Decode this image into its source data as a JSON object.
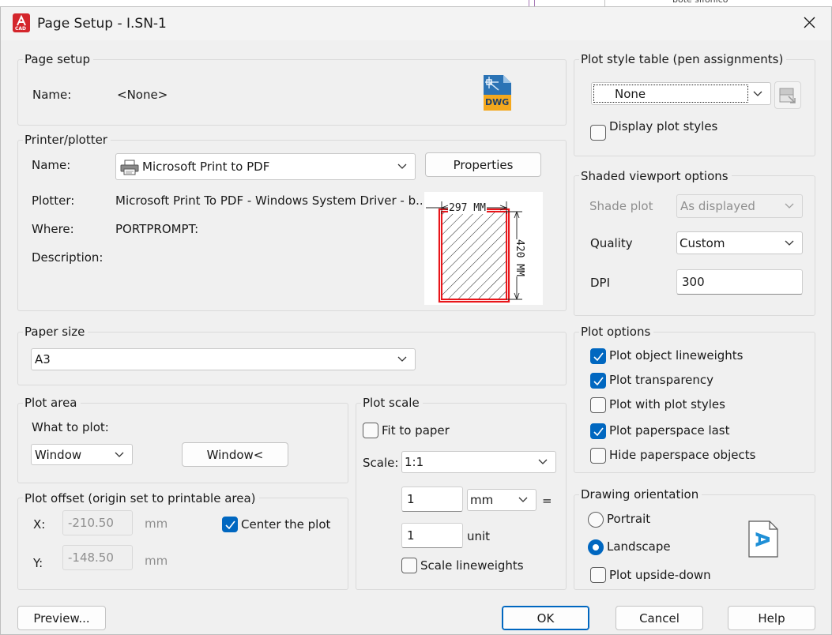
{
  "window": {
    "title": "Page Setup - I.SN-1",
    "app_badge": "CAD",
    "background_text": "bote sifonico"
  },
  "page_setup": {
    "group_label": "Page setup",
    "name_label": "Name:",
    "name_value": "<None>",
    "file_icon_text": "DWG"
  },
  "printer": {
    "group_label": "Printer/plotter",
    "name_label": "Name:",
    "name_value": "Microsoft Print to PDF",
    "properties_button": "Properties",
    "plotter_label": "Plotter:",
    "plotter_value": "Microsoft Print To PDF - Windows System Driver - b...",
    "where_label": "Where:",
    "where_value": "PORTPROMPT:",
    "description_label": "Description:",
    "preview_width_label": "297 MM",
    "preview_height_label": "420 MM"
  },
  "paper_size": {
    "group_label": "Paper size",
    "value": "A3"
  },
  "plot_area": {
    "group_label": "Plot area",
    "what_label": "What to plot:",
    "what_value": "Window",
    "window_button": "Window<"
  },
  "plot_offset": {
    "group_label": "Plot offset (origin set to printable area)",
    "x_label": "X:",
    "x_value": "-210.50",
    "x_unit": "mm",
    "y_label": "Y:",
    "y_value": "-148.50",
    "y_unit": "mm",
    "center_label": "Center the plot",
    "center_checked": true
  },
  "plot_scale": {
    "group_label": "Plot scale",
    "fit_label": "Fit to paper",
    "fit_checked": false,
    "scale_label": "Scale:",
    "scale_value": "1:1",
    "value1": "1",
    "unit1": "mm",
    "equals": "=",
    "value2": "1",
    "unit2": "unit",
    "lineweights_label": "Scale lineweights",
    "lineweights_checked": false
  },
  "plot_style": {
    "group_label": "Plot style table (pen assignments)",
    "value": "None",
    "display_label": "Display plot styles",
    "display_checked": false
  },
  "shaded": {
    "group_label": "Shaded viewport options",
    "shade_label": "Shade plot",
    "shade_value": "As displayed",
    "quality_label": "Quality",
    "quality_value": "Custom",
    "dpi_label": "DPI",
    "dpi_value": "300"
  },
  "plot_options": {
    "group_label": "Plot options",
    "items": [
      {
        "label": "Plot object lineweights",
        "checked": true
      },
      {
        "label": "Plot transparency",
        "checked": true
      },
      {
        "label": "Plot with plot styles",
        "checked": false
      },
      {
        "label": "Plot paperspace last",
        "checked": true
      },
      {
        "label": "Hide paperspace objects",
        "checked": false
      }
    ]
  },
  "orientation": {
    "group_label": "Drawing orientation",
    "portrait_label": "Portrait",
    "landscape_label": "Landscape",
    "selected": "Landscape",
    "upside_label": "Plot upside-down",
    "upside_checked": false,
    "icon_glyph": "A"
  },
  "footer": {
    "preview_button": "Preview...",
    "ok_button": "OK",
    "cancel_button": "Cancel",
    "help_button": "Help"
  },
  "colors": {
    "accent": "#0067c0",
    "app_red": "#d4262c",
    "preview_red": "#e8161b"
  }
}
